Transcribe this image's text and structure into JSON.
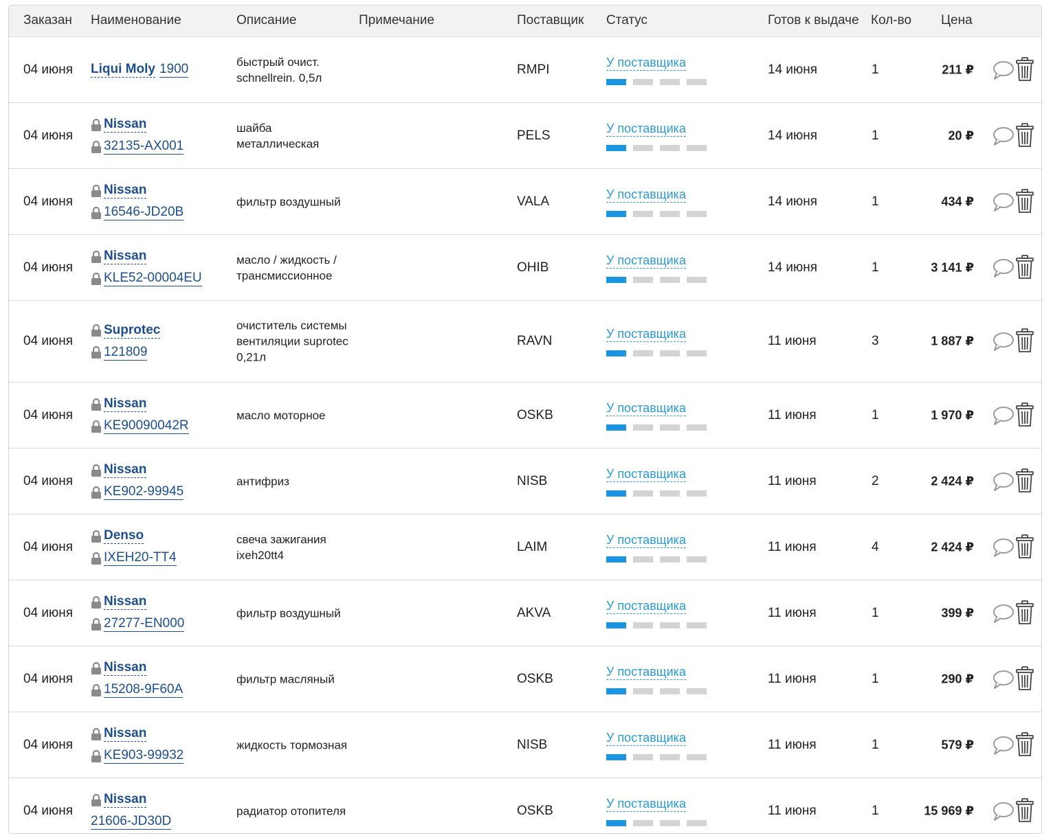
{
  "columns": {
    "ordered": "Заказан",
    "name": "Наименование",
    "description": "Описание",
    "note": "Примечание",
    "supplier": "Поставщик",
    "status": "Статус",
    "ready": "Готов к выдаче",
    "qty": "Кол-во",
    "price": "Цена"
  },
  "colors": {
    "link": "#1d4f8f",
    "status": "#2b9ad8",
    "progress_active": "#1b95e0",
    "progress_inactive": "#d4d4d4"
  },
  "icons": [
    "lock-icon",
    "comment-icon",
    "trash-icon"
  ],
  "rows": [
    {
      "ordered": "04 июня",
      "brand": "Liqui Moly",
      "article": "1900",
      "locked": false,
      "description": "быстрый очист. schnellrein. 0,5л",
      "note": "",
      "supplier": "RMPI",
      "status": "У поставщика",
      "progress": 1,
      "ready": "14 июня",
      "qty": "1",
      "price": "211 ₽"
    },
    {
      "ordered": "04 июня",
      "brand": "Nissan",
      "article": "32135-AX001",
      "locked": true,
      "description": "шайба металлическая",
      "note": "",
      "supplier": "PELS",
      "status": "У поставщика",
      "progress": 1,
      "ready": "14 июня",
      "qty": "1",
      "price": "20 ₽"
    },
    {
      "ordered": "04 июня",
      "brand": "Nissan",
      "article": "16546-JD20B",
      "locked": true,
      "description": "фильтр воздушный",
      "note": "",
      "supplier": "VALA",
      "status": "У поставщика",
      "progress": 1,
      "ready": "14 июня",
      "qty": "1",
      "price": "434 ₽"
    },
    {
      "ordered": "04 июня",
      "brand": "Nissan",
      "article": "KLE52-00004EU",
      "locked": true,
      "description": "масло / жидкость / трансмиссионное",
      "note": "",
      "supplier": "OHIB",
      "status": "У поставщика",
      "progress": 1,
      "ready": "14 июня",
      "qty": "1",
      "price": "3 141 ₽"
    },
    {
      "ordered": "04 июня",
      "brand": "Suprotec",
      "article": "121809",
      "locked": true,
      "description": "очиститель системы вентиляции suprotec 0,21л",
      "note": "",
      "supplier": "RAVN",
      "status": "У поставщика",
      "progress": 1,
      "ready": "11 июня",
      "qty": "3",
      "price": "1 887 ₽"
    },
    {
      "ordered": "04 июня",
      "brand": "Nissan",
      "article": "KE90090042R",
      "locked": true,
      "description": "масло моторное",
      "note": "",
      "supplier": "OSKB",
      "status": "У поставщика",
      "progress": 1,
      "ready": "11 июня",
      "qty": "1",
      "price": "1 970 ₽"
    },
    {
      "ordered": "04 июня",
      "brand": "Nissan",
      "article": "KE902-99945",
      "locked": true,
      "description": "антифриз",
      "note": "",
      "supplier": "NISB",
      "status": "У поставщика",
      "progress": 1,
      "ready": "11 июня",
      "qty": "2",
      "price": "2 424 ₽"
    },
    {
      "ordered": "04 июня",
      "brand": "Denso",
      "article": "IXEH20-TT4",
      "locked": true,
      "description": "свеча зажигания ixeh20tt4",
      "note": "",
      "supplier": "LAIM",
      "status": "У поставщика",
      "progress": 1,
      "ready": "11 июня",
      "qty": "4",
      "price": "2 424 ₽"
    },
    {
      "ordered": "04 июня",
      "brand": "Nissan",
      "article": "27277-EN000",
      "locked": true,
      "description": "фильтр воздушный",
      "note": "",
      "supplier": "AKVA",
      "status": "У поставщика",
      "progress": 1,
      "ready": "11 июня",
      "qty": "1",
      "price": "399 ₽"
    },
    {
      "ordered": "04 июня",
      "brand": "Nissan",
      "article": "15208-9F60A",
      "locked": true,
      "description": "фильтр масляный",
      "note": "",
      "supplier": "OSKB",
      "status": "У поставщика",
      "progress": 1,
      "ready": "11 июня",
      "qty": "1",
      "price": "290 ₽"
    },
    {
      "ordered": "04 июня",
      "brand": "Nissan",
      "article": "KE903-99932",
      "locked": true,
      "description": "жидкость тормозная",
      "note": "",
      "supplier": "NISB",
      "status": "У поставщика",
      "progress": 1,
      "ready": "11 июня",
      "qty": "1",
      "price": "579 ₽"
    },
    {
      "ordered": "04 июня",
      "brand": "Nissan",
      "article": "21606-JD30D",
      "locked": true,
      "article_locked": false,
      "description": "радиатор отопителя",
      "note": "",
      "supplier": "OSKB",
      "status": "У поставщика",
      "progress": 1,
      "ready": "11 июня",
      "qty": "1",
      "price": "15 969 ₽"
    }
  ]
}
